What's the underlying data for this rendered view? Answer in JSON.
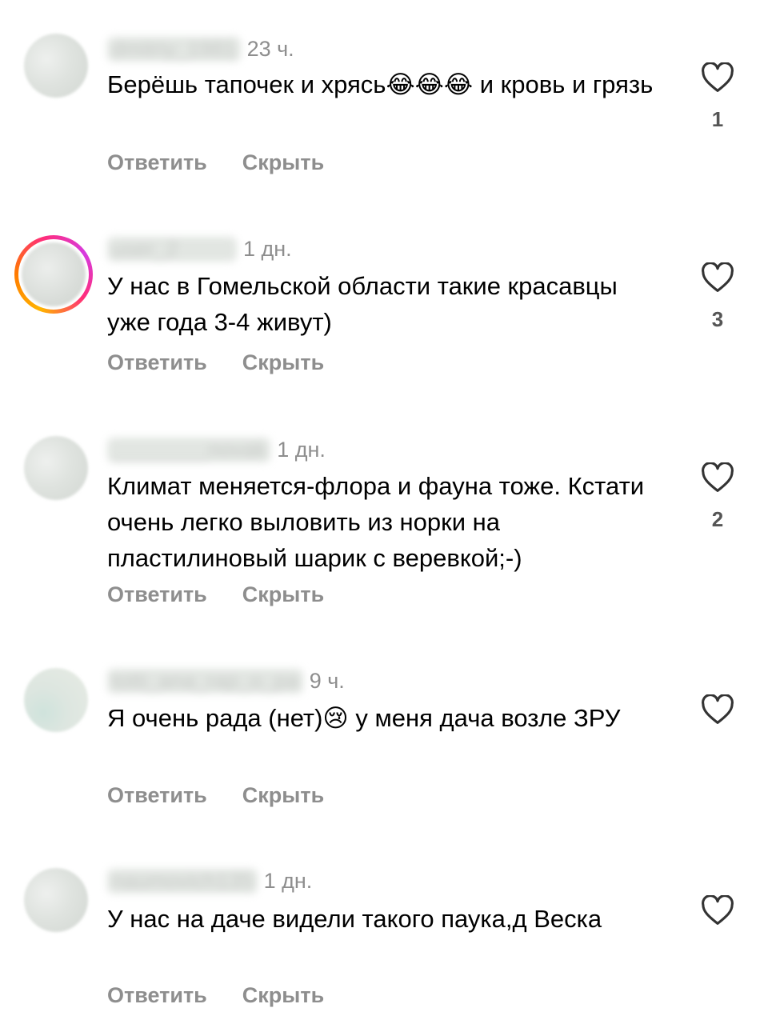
{
  "comments": [
    {
      "username": "dmitriy_1981",
      "time": "23 ч.",
      "text": "Берёшь тапочек и хрясь😂😂😂 и кровь и грязь",
      "likes": "1",
      "reply_label": "Ответить",
      "hide_label": "Скрыть"
    },
    {
      "username": "user_2",
      "time": "1 дн.",
      "text": "У нас в Гомельской области такие красавцы уже года 3-4 живут)",
      "likes": "3",
      "reply_label": "Ответить",
      "hide_label": "Скрыть"
    },
    {
      "username": "________novak",
      "time": "1 дн.",
      "text": "Климат меняется-флора и фауна тоже. Кстати очень легко выловить из норки на пластилиновый шарик с веревкой;-)",
      "likes": "2",
      "reply_label": "Ответить",
      "hide_label": "Скрыть"
    },
    {
      "username": "totti_ana_rap_o_pa",
      "time": "9 ч.",
      "text": "Я очень рада (нет)😢 у меня дача возле ЗРУ",
      "likes": "",
      "reply_label": "Ответить",
      "hide_label": "Скрыть"
    },
    {
      "username": "naumovich135",
      "time": "1 дн.",
      "text": "У нас на даче видели такого паука,д Веска",
      "likes": "",
      "reply_label": "Ответить",
      "hide_label": "Скрыть"
    }
  ],
  "icons": {
    "like": "heart-outline-icon"
  },
  "colors": {
    "meta": "#8e8e8e",
    "text": "#000000",
    "story_ring": "#ff2d7a"
  }
}
